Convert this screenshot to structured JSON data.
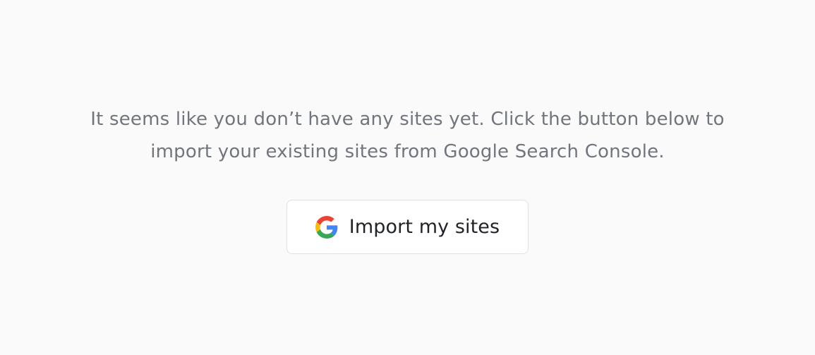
{
  "empty_state": {
    "message_line_1": "It seems like you don’t have any sites yet. Click the button below to",
    "message_line_2": "import your existing sites from Google Search Console.",
    "import_button": {
      "label": "Import my sites",
      "icon": "google-icon"
    }
  },
  "colors": {
    "background": "#fafafa",
    "message_text": "#71757d",
    "button_text": "#1f2328",
    "button_border": "#dfe1e5"
  }
}
